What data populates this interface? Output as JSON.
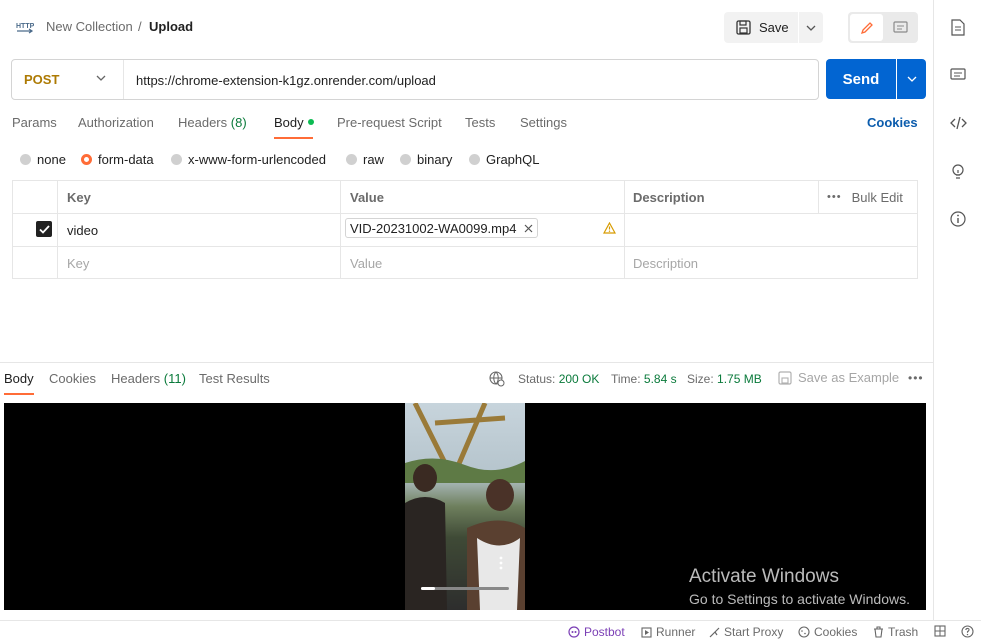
{
  "breadcrumb": {
    "collection": "New Collection",
    "separator": "/",
    "current": "Upload"
  },
  "toolbar": {
    "save_label": "Save"
  },
  "request": {
    "method": "POST",
    "url": "https://chrome-extension-k1gz.onrender.com/upload",
    "send_label": "Send"
  },
  "request_tabs": {
    "params": "Params",
    "authorization": "Authorization",
    "headers": "Headers",
    "headers_count": "(8)",
    "body": "Body",
    "pre_request": "Pre-request Script",
    "tests": "Tests",
    "settings": "Settings",
    "cookies": "Cookies"
  },
  "body_types": {
    "none": "none",
    "form_data": "form-data",
    "urlencoded": "x-www-form-urlencoded",
    "raw": "raw",
    "binary": "binary",
    "graphql": "GraphQL",
    "selected": "form-data"
  },
  "form_table": {
    "headers": {
      "key": "Key",
      "value": "Value",
      "description": "Description",
      "bulk_edit": "Bulk Edit"
    },
    "rows": [
      {
        "checked": true,
        "key": "video",
        "file": "VID-20231002-WA0099.mp4",
        "description": ""
      }
    ],
    "placeholder": {
      "key": "Key",
      "value": "Value",
      "description": "Description"
    }
  },
  "response": {
    "tabs": {
      "body": "Body",
      "cookies": "Cookies",
      "headers": "Headers",
      "headers_count": "(11)",
      "test_results": "Test Results"
    },
    "status_label": "Status:",
    "status_value": "200 OK",
    "time_label": "Time:",
    "time_value": "5.84 s",
    "size_label": "Size:",
    "size_value": "1.75 MB",
    "save_example": "Save as Example"
  },
  "watermark": {
    "line1": "Activate Windows",
    "line2": "Go to Settings to activate Windows."
  },
  "statusbar": {
    "postbot": "Postbot",
    "runner": "Runner",
    "start_proxy": "Start Proxy",
    "cookies": "Cookies",
    "trash": "Trash"
  },
  "colors": {
    "accent": "#ff6c37",
    "send": "#0265d2",
    "method_post": "#ad7a03",
    "ok": "#0a7a3b"
  }
}
